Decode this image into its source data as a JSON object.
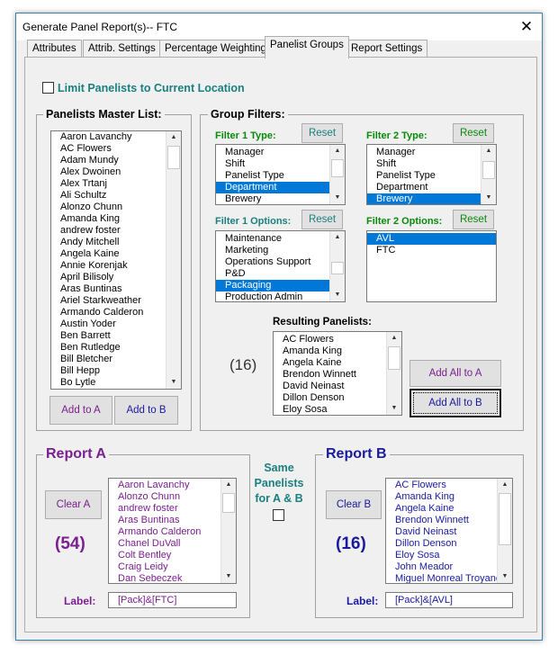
{
  "window": {
    "title": "Generate Panel Report(s)-- FTC",
    "close_glyph": "✕"
  },
  "tabs": [
    {
      "label": "Attributes"
    },
    {
      "label": "Attrib. Settings"
    },
    {
      "label": "Percentage Weighting"
    },
    {
      "label": "Panelist Groups"
    },
    {
      "label": "Report Settings"
    }
  ],
  "limit": {
    "label": "Limit Panelists to Current Location",
    "checked": false
  },
  "master": {
    "title": "Panelists Master List:",
    "items": [
      "Aaron Lavanchy",
      "AC Flowers",
      "Adam Mundy",
      "Alex Dwoinen",
      "Alex Trtanj",
      "Ali Schultz",
      "Alonzo Chunn",
      "Amanda King",
      "andrew foster",
      "Andy Mitchell",
      "Angela Kaine",
      "Annie Korenjak",
      "April Bilisoly",
      "Aras Buntinas",
      "Ariel Starkweather",
      "Armando Calderon",
      "Austin Yoder",
      "Ben Barrett",
      "Ben Rutledge",
      "Bill Bletcher",
      "Bill Hepp",
      "Bo Lytle"
    ],
    "add_a": "Add to A",
    "add_b": "Add to B"
  },
  "filters": {
    "title": "Group Filters:",
    "f1type": {
      "label": "Filter 1 Type:",
      "reset": "Reset",
      "items": [
        "Manager",
        "Shift",
        "Panelist Type",
        "Department",
        "Brewery"
      ],
      "selected": 3
    },
    "f2type": {
      "label": "Filter 2 Type:",
      "reset": "Reset",
      "items": [
        "Manager",
        "Shift",
        "Panelist Type",
        "Department",
        "Brewery"
      ],
      "selected": 4
    },
    "f1opt": {
      "label": "Filter 1 Options:",
      "reset": "Reset",
      "items": [
        "Maintenance",
        "Marketing",
        "Operations Support",
        "P&D",
        "Packaging",
        "Production Admin"
      ],
      "selected": 4
    },
    "f2opt": {
      "label": "Filter 2 Options:",
      "reset": "Reset",
      "items": [
        "AVL",
        "FTC"
      ],
      "selected": 0
    }
  },
  "resulting": {
    "label": "Resulting Panelists:",
    "count": "(16)",
    "items": [
      "AC Flowers",
      "Amanda King",
      "Angela Kaine",
      "Brendon Winnett",
      "David Neinast",
      "Dillon Denson",
      "Eloy Sosa"
    ],
    "add_all_a": "Add All to A",
    "add_all_b": "Add All to B"
  },
  "report_a": {
    "title": "Report A",
    "clear": "Clear A",
    "count": "(54)",
    "items": [
      "Aaron Lavanchy",
      "Alonzo Chunn",
      "andrew foster",
      "Aras Buntinas",
      "Armando Calderon",
      "Chanel DuVall",
      "Colt Bentley",
      "Craig Leidy",
      "Dan Sebeczek"
    ],
    "label_caption": "Label:",
    "label_value": "[Pack]&[FTC]"
  },
  "same": {
    "text": "Same Panelists for A & B",
    "checked": false
  },
  "report_b": {
    "title": "Report B",
    "clear": "Clear B",
    "count": "(16)",
    "items": [
      "AC Flowers",
      "Amanda King",
      "Angela Kaine",
      "Brendon Winnett",
      "David Neinast",
      "Dillon Denson",
      "Eloy Sosa",
      "John Meador",
      "Miguel Monreal Troyano"
    ],
    "label_caption": "Label:",
    "label_value": "[Pack]&[AVL]"
  },
  "colors": {
    "accent_teal": "#1a7f7f",
    "green": "#0a8a0a",
    "purple": "#7a1f8f",
    "blue": "#1a1aa0",
    "selection": "#0078d7"
  }
}
